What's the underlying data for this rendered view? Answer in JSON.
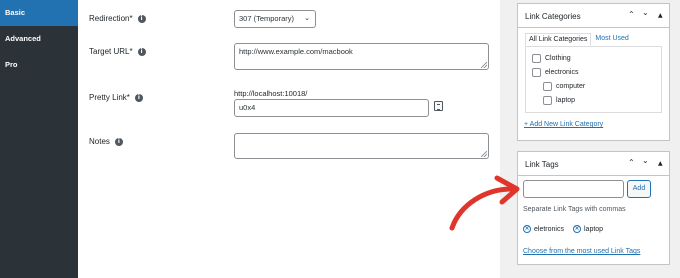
{
  "tabs": [
    "Basic",
    "Advanced",
    "Pro"
  ],
  "form": {
    "redirection_label": "Redirection*",
    "redirection_value": "307 (Temporary)",
    "target_url_label": "Target URL*",
    "target_url_value": "http://www.example.com/macbook",
    "pretty_link_label": "Pretty Link*",
    "pretty_link_host": "http://localhost:10018/",
    "pretty_link_slug": "u0x4",
    "notes_label": "Notes"
  },
  "categories_box": {
    "title": "Link Categories",
    "tab_all": "All Link Categories",
    "tab_most_used": "Most Used",
    "items": [
      "Clothing",
      "electronics",
      "computer",
      "laptop"
    ],
    "add_link": "+ Add New Link Category"
  },
  "tags_box": {
    "title": "Link Tags",
    "add_button": "Add",
    "hint": "Separate Link Tags with commas",
    "tags": [
      "eletronics",
      "laptop"
    ],
    "choose_link": "Choose from the most used Link Tags"
  },
  "colors": {
    "accent": "#2271b1",
    "sidebar_bg": "#2c3338",
    "arrow": "#e0352b"
  }
}
